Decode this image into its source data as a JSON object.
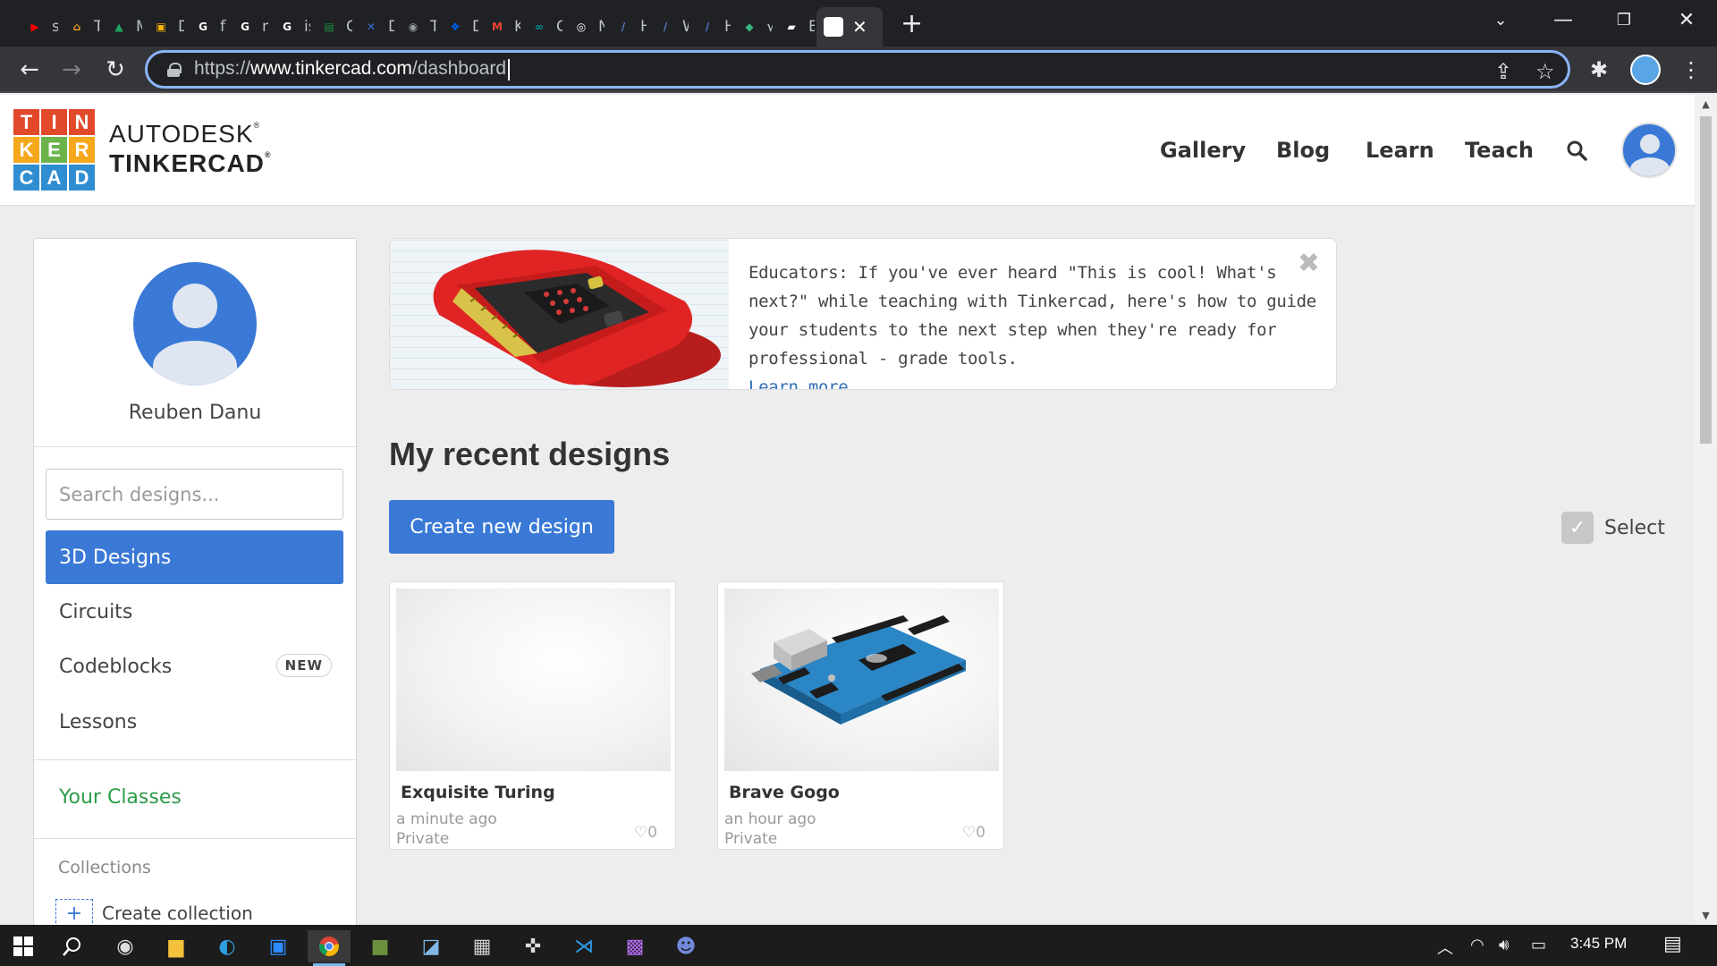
{
  "browser": {
    "tabs": [
      {
        "label": "sp",
        "color": "#ff0000",
        "glyph": "▶"
      },
      {
        "label": "Ta",
        "color": "#f29b27",
        "glyph": "⌂"
      },
      {
        "label": "M",
        "color": "#1fa463",
        "glyph": "▲"
      },
      {
        "label": "Di",
        "color": "#f4b400",
        "glyph": "▣"
      },
      {
        "label": "flo",
        "color": "#ffffff",
        "glyph": "G"
      },
      {
        "label": "m",
        "color": "#ffffff",
        "glyph": "G"
      },
      {
        "label": "is",
        "color": "#ffffff",
        "glyph": "G"
      },
      {
        "label": "Ca",
        "color": "#1e8e3e",
        "glyph": "▤"
      },
      {
        "label": "Di",
        "color": "#3b6fe0",
        "glyph": "✕"
      },
      {
        "label": "Tu",
        "color": "#9aa0a6",
        "glyph": "◉"
      },
      {
        "label": "Dr",
        "color": "#0061fe",
        "glyph": "❖"
      },
      {
        "label": "Ko",
        "color": "#ea4335",
        "glyph": "M"
      },
      {
        "label": "Ge",
        "color": "#00979d",
        "glyph": "∞"
      },
      {
        "label": "N",
        "color": "#ffffff",
        "glyph": "◎"
      },
      {
        "label": "He",
        "color": "#5b7cd6",
        "glyph": "/"
      },
      {
        "label": "W",
        "color": "#5b7cd6",
        "glyph": "/"
      },
      {
        "label": "He",
        "color": "#5b7cd6",
        "glyph": "/"
      },
      {
        "label": "√",
        "color": "#36b37e",
        "glyph": "◆"
      },
      {
        "label": "Bl",
        "color": "#ffffff",
        "glyph": "▰"
      }
    ],
    "active_tab_close": "✕",
    "new_tab": "+",
    "url_prefix": "https://",
    "url_domain": "www.tinkercad.com",
    "url_path": "/dashboard"
  },
  "header": {
    "logo_letters": [
      "T",
      "I",
      "N",
      "K",
      "E",
      "R",
      "C",
      "A",
      "D"
    ],
    "logo_colors": [
      "#e2492b",
      "#e2492b",
      "#e2492b",
      "#f6a81c",
      "#6bb34a",
      "#f6a81c",
      "#2f8ed1",
      "#2f8ed1",
      "#2f8ed1"
    ],
    "brand_line1": "AUTODESK",
    "brand_line2": "TINKERCAD",
    "nav": [
      "Gallery",
      "Blog",
      "Learn",
      "Teach"
    ]
  },
  "sidebar": {
    "username": "Reuben Danu",
    "search_placeholder": "Search designs...",
    "items": [
      {
        "label": "3D Designs",
        "active": true
      },
      {
        "label": "Circuits"
      },
      {
        "label": "Codeblocks",
        "badge": "NEW"
      },
      {
        "label": "Lessons"
      }
    ],
    "your_classes": "Your Classes",
    "collections_heading": "Collections",
    "create_collection": "Create collection"
  },
  "banner": {
    "text": "Educators: If you've ever heard \"This is cool! What's next?\" while teaching with Tinkercad, here's how to guide your students to the next step when they're ready for professional - grade tools.",
    "link": "Learn more"
  },
  "main": {
    "heading": "My recent designs",
    "create_button": "Create new design",
    "select_label": "Select",
    "designs": [
      {
        "title": "Exquisite Turing",
        "time": "a minute ago",
        "privacy": "Private",
        "likes": "0"
      },
      {
        "title": "Brave Gogo",
        "time": "an hour ago",
        "privacy": "Private",
        "likes": "0"
      }
    ]
  },
  "taskbar": {
    "clock": "3:45 PM"
  }
}
